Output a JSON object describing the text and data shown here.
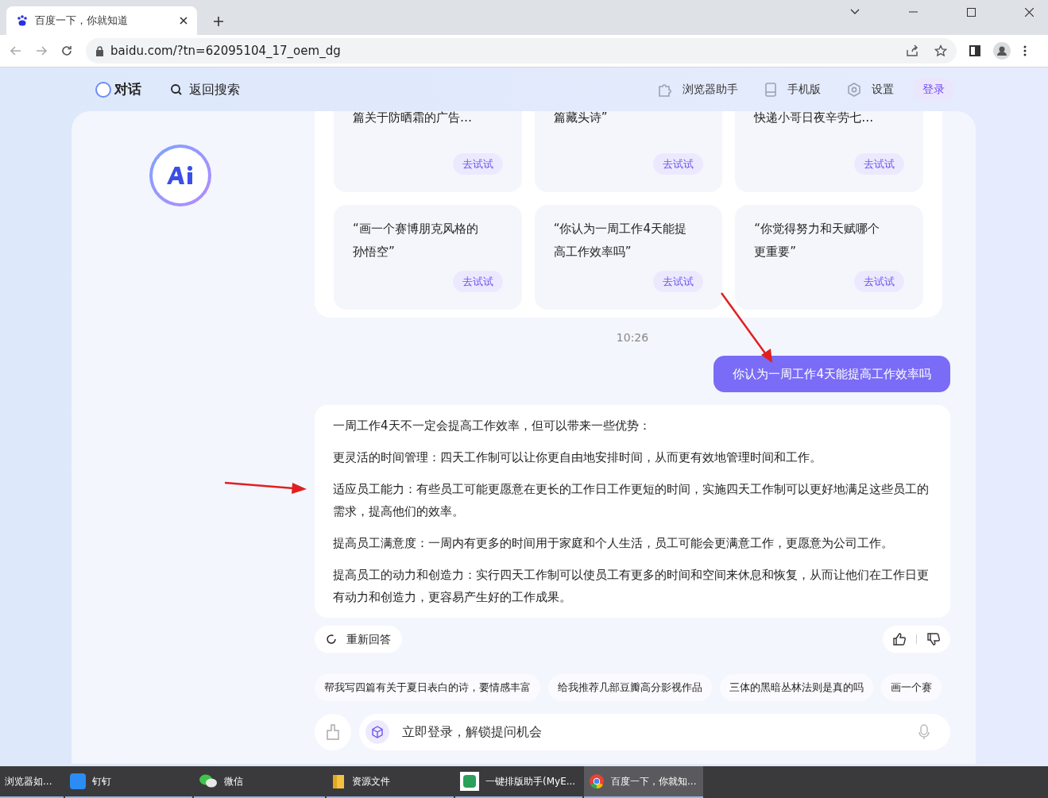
{
  "browser": {
    "tab_title": "百度一下，你就知道",
    "url": "baidu.com/?tn=62095104_17_oem_dg"
  },
  "header": {
    "chat": "对话",
    "back_search": "返回搜索",
    "links": [
      {
        "kind": "puzzle",
        "label": "浏览器助手"
      },
      {
        "kind": "phone",
        "label": "手机版"
      },
      {
        "kind": "gear",
        "label": "设置"
      }
    ],
    "login": "登录"
  },
  "cards": [
    {
      "lines": [
        "篇关于防晒霜的广告…"
      ],
      "action": "去试试"
    },
    {
      "lines": [
        "篇藏头诗”"
      ],
      "action": "去试试"
    },
    {
      "lines": [
        "快递小哥日夜辛劳七…"
      ],
      "action": "去试试"
    },
    {
      "lines": [
        "“画一个赛博朋克风格的",
        "孙悟空”"
      ],
      "action": "去试试"
    },
    {
      "lines": [
        "“你认为一周工作4天能提",
        "高工作效率吗”"
      ],
      "action": "去试试"
    },
    {
      "lines": [
        "“你觉得努力和天赋哪个",
        "更重要”"
      ],
      "action": "去试试"
    }
  ],
  "time": "10:26",
  "user_message": "你认为一周工作4天能提高工作效率吗",
  "answer": [
    "一周工作4天不一定会提高工作效率，但可以带来一些优势：",
    "更灵活的时间管理：四天工作制可以让你更自由地安排时间，从而更有效地管理时间和工作。",
    "适应员工能力：有些员工可能更愿意在更长的工作日工作更短的时间，实施四天工作制可以更好地满足这些员工的需求，提高他们的效率。",
    "提高员工满意度：一周内有更多的时间用于家庭和个人生活，员工可能会更满意工作，更愿意为公司工作。",
    "提高员工的动力和创造力：实行四天工作制可以使员工有更多的时间和空间来休息和恢复，从而让他们在工作日更有动力和创造力，更容易产生好的工作成果。"
  ],
  "regenerate": "重新回答",
  "suggestions": [
    "帮我写四篇有关于夏日表白的诗，要情感丰富",
    "给我推荐几部豆瓣高分影视作品",
    "三体的黑暗丛林法则是真的吗",
    "画一个赛"
  ],
  "input": {
    "placeholder": "立即登录，解锁提问机会"
  },
  "taskbar": [
    {
      "kind": "browser",
      "label": "浏览器如...",
      "selected": false
    },
    {
      "kind": "dingtalk",
      "label": "钉钉",
      "selected": false
    },
    {
      "kind": "wechat",
      "label": "微信",
      "selected": false
    },
    {
      "kind": "folder",
      "label": "资源文件",
      "selected": false
    },
    {
      "kind": "app",
      "label": "一键排版助手(MyE...",
      "selected": false
    },
    {
      "kind": "chrome",
      "label": "百度一下，你就知...",
      "selected": true
    }
  ]
}
